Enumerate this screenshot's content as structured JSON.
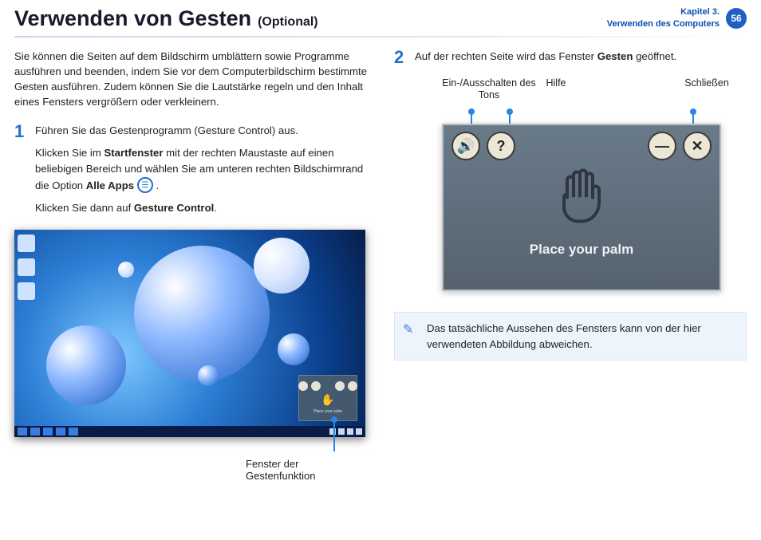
{
  "header": {
    "title": "Verwenden von Gesten",
    "optional": "(Optional)",
    "chapter_line1": "Kapitel 3.",
    "chapter_line2": "Verwenden des Computers",
    "page_number": "56"
  },
  "left": {
    "intro": "Sie können die Seiten auf dem Bildschirm umblättern sowie Programme ausführen und beenden, indem Sie vor dem Computerbildschirm bestimmte Gesten ausführen. Zudem können Sie die Lautstärke regeln und den Inhalt eines Fensters vergrößern oder verkleinern.",
    "step1_num": "1",
    "step1_p1": "Führen Sie das Gestenprogramm (Gesture Control) aus.",
    "step1_p2a": "Klicken Sie im ",
    "step1_p2b": "Startfenster",
    "step1_p2c": " mit der rechten Maustaste auf einen beliebigen Bereich und wählen Sie am unteren rechten Bildschirmrand die Option ",
    "step1_p2d": "Alle Apps",
    "step1_p2e": " .",
    "step1_p3a": "Klicken Sie dann auf ",
    "step1_p3b": "Gesture Control",
    "step1_p3c": ".",
    "mini_text": "Place your palm",
    "caption": "Fenster der Gestenfunktion"
  },
  "right": {
    "step2_num": "2",
    "step2_a": "Auf der rechten Seite wird das Fenster ",
    "step2_b": "Gesten",
    "step2_c": " geöffnet.",
    "label_sound": "Ein-/Ausschalten des Tons",
    "label_help": "Hilfe",
    "label_close": "Schließen",
    "btn_sound_glyph": "🔊",
    "btn_help_glyph": "?",
    "btn_min_glyph": "—",
    "btn_close_glyph": "✕",
    "place_palm": "Place your palm",
    "note": "Das tatsächliche Aussehen des Fensters kann von der hier verwendeten Abbildung abweichen."
  }
}
